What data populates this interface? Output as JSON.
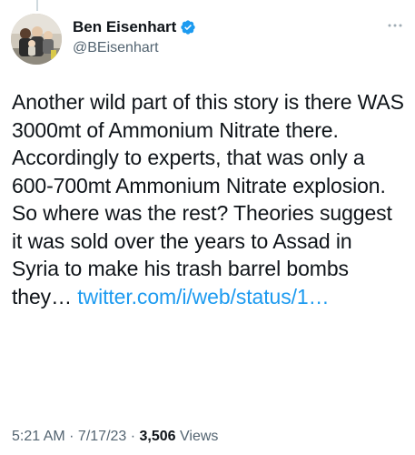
{
  "author": {
    "display_name": "Ben Eisenhart",
    "handle": "@BEisenhart",
    "verified": true,
    "avatar": "family-photo-avatar"
  },
  "tweet": {
    "text": "Another wild part of this story is there WAS 3000mt of Ammonium Nitrate there. Accordingly to experts, that was only a 600-700mt Ammonium Nitrate explosion. So where was the rest? Theories suggest it was sold over the years to Assad in Syria to make his trash barrel bombs they… ",
    "link_text": "twitter.com/i/web/status/1…"
  },
  "meta": {
    "time": "5:21 AM",
    "separator1": " · ",
    "date": "7/17/23",
    "separator2": " · ",
    "views_count": "3,506",
    "views_label": " Views"
  },
  "icons": {
    "verified": "verified-badge-icon",
    "more": "more-options-icon"
  },
  "colors": {
    "link": "#1d9bf0",
    "secondary_text": "#536471",
    "primary_text": "#0f1419",
    "verified": "#1d9bf0"
  }
}
